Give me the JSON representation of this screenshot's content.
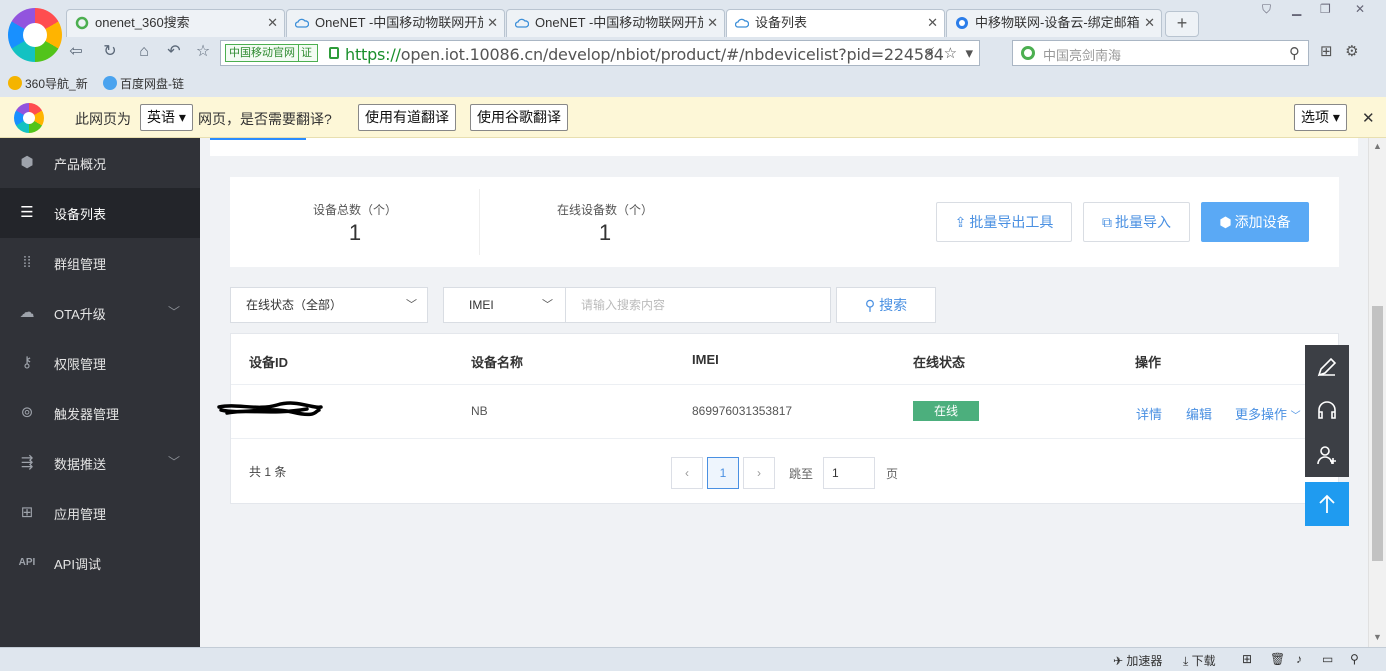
{
  "browser": {
    "tabs": [
      {
        "title": "onenet_360搜索",
        "active": false
      },
      {
        "title": "OneNET -中国移动物联网开放",
        "active": false
      },
      {
        "title": "OneNET -中国移动物联网开放",
        "active": false
      },
      {
        "title": "设备列表",
        "active": true
      },
      {
        "title": "中移物联网-设备云-绑定邮箱",
        "active": false
      }
    ],
    "new_tab": "+",
    "cmcc_badge": "中国移动官网",
    "cert_badge": "证",
    "url_scheme": "https://",
    "url_rest": "open.iot.10086.cn/develop/nbiot/product/#/nbdevicelist?pid=224584",
    "search_placeholder": "中国亮剑南海",
    "bookmarks": [
      "360导航_新",
      "百度网盘-链"
    ]
  },
  "translate_bar": {
    "prefix": "此网页为",
    "language": "英语",
    "question": "网页，是否需要翻译?",
    "youdao_button": "使用有道翻译",
    "google_button": "使用谷歌翻译",
    "options_button": "选项"
  },
  "sidebar": {
    "items": [
      {
        "label": "产品概况",
        "icon": "cube-icon",
        "active": false
      },
      {
        "label": "设备列表",
        "icon": "list-icon",
        "active": true
      },
      {
        "label": "群组管理",
        "icon": "grid-dots-icon",
        "active": false
      },
      {
        "label": "OTA升级",
        "icon": "cloud-icon",
        "active": false,
        "expandable": true
      },
      {
        "label": "权限管理",
        "icon": "key-icon",
        "active": false
      },
      {
        "label": "触发器管理",
        "icon": "trigger-icon",
        "active": false
      },
      {
        "label": "数据推送",
        "icon": "push-icon",
        "active": false,
        "expandable": true
      },
      {
        "label": "应用管理",
        "icon": "apps-icon",
        "active": false
      },
      {
        "label": "API调试",
        "icon": "api-icon",
        "active": false
      }
    ]
  },
  "stats": {
    "total_label": "设备总数（个）",
    "total_value": "1",
    "online_label": "在线设备数（个）",
    "online_value": "1"
  },
  "actions": {
    "export_tool": "批量导出工具",
    "import": "批量导入",
    "add_device": "添加设备"
  },
  "filters": {
    "status_select": "在线状态（全部）",
    "field_select": "IMEI",
    "search_placeholder": "请输入搜索内容",
    "search_button": "搜索"
  },
  "table": {
    "headers": [
      "设备ID",
      "设备名称",
      "IMEI",
      "在线状态",
      "操作"
    ],
    "rows": [
      {
        "device_name": "NB",
        "imei": "869976031353817",
        "status": "在线",
        "ops": [
          "详情",
          "编辑",
          "更多操作"
        ]
      }
    ]
  },
  "pagination": {
    "total_text": "共 1 条",
    "prev": "‹",
    "current_page": "1",
    "next": "›",
    "jump_label": "跳至",
    "jump_value": "1",
    "page_suffix": "页"
  },
  "status_bar": {
    "accelerator": "加速器",
    "download": "下载"
  },
  "colors": {
    "sidebar_bg": "#303238",
    "accent": "#4a90e2",
    "primary_button": "#5aa9f5",
    "online_badge": "#4caf7d",
    "back_to_top": "#1f9bf0"
  }
}
